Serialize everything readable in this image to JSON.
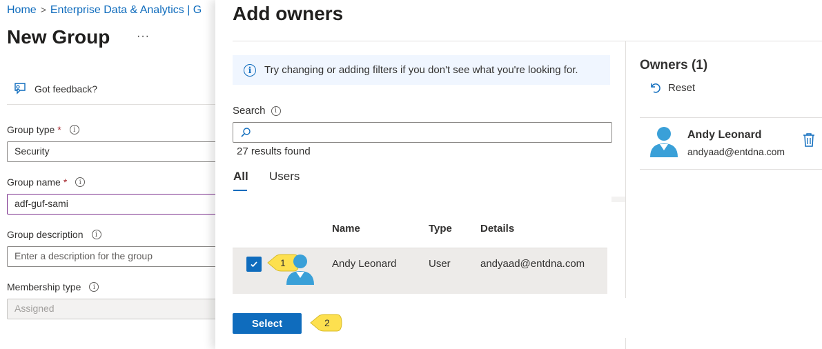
{
  "breadcrumb": {
    "home": "Home",
    "current": "Enterprise Data & Analytics | G"
  },
  "page": {
    "title": "New Group",
    "more": "···",
    "feedback": "Got feedback?"
  },
  "form": {
    "group_type_label": "Group type",
    "group_type_value": "Security",
    "group_name_label": "Group name",
    "group_name_value": "adf-guf-sami",
    "group_description_label": "Group description",
    "group_description_placeholder": "Enter a description for the group",
    "membership_type_label": "Membership type",
    "membership_type_value": "Assigned",
    "required_mark": "*",
    "info_glyph": "i"
  },
  "panel": {
    "title": "Add owners",
    "banner": "Try changing or adding filters if you don't see what you're looking for.",
    "search_label": "Search",
    "search_value": "",
    "results": "27 results found",
    "tabs": [
      "All",
      "Users"
    ],
    "columns": [
      "Name",
      "Type",
      "Details"
    ],
    "rows": [
      {
        "name": "Andy Leonard",
        "type": "User",
        "details": "andyaad@entdna.com",
        "checked": true
      }
    ],
    "select_label": "Select"
  },
  "owners": {
    "title": "Owners (1)",
    "reset_label": "Reset",
    "items": [
      {
        "name": "Andy Leonard",
        "email": "andyaad@entdna.com"
      }
    ]
  },
  "callouts": [
    "1",
    "2"
  ],
  "colors": {
    "accent": "#0f6cbd",
    "callout": "#fde04f",
    "avatar": "#3aa0d8"
  },
  "icons": [
    "chevron-right-icon",
    "feedback-icon",
    "info-icon",
    "search-icon",
    "checkmark-icon",
    "user-avatar-icon",
    "reset-icon",
    "trash-icon"
  ]
}
